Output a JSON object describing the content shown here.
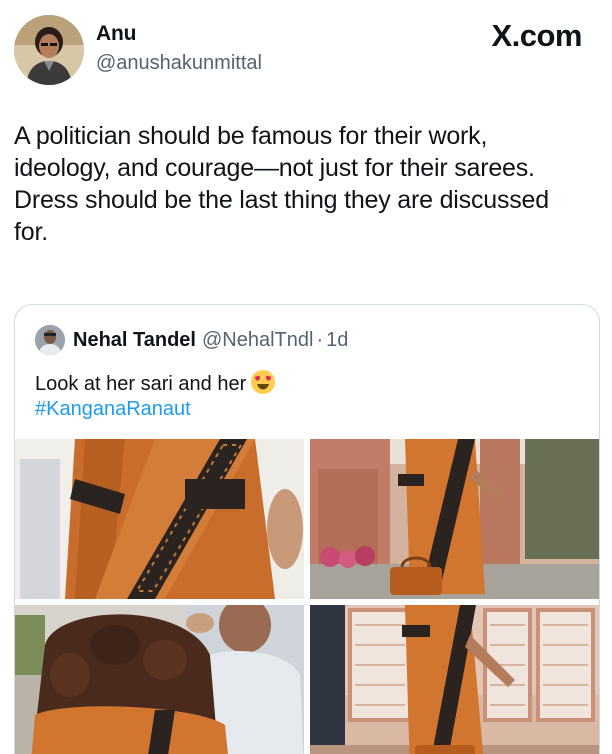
{
  "watermark": "X.com",
  "tweet": {
    "author_name": "Anu",
    "author_handle": "@anushakunmittal",
    "lines": [
      "A politician should be famous for their work,",
      "ideology, and courage—not just for their sarees.",
      "Dress should be the last thing they are discussed",
      "for."
    ]
  },
  "quoted": {
    "author_name": "Nehal Tandel",
    "author_handle": "@NehalTndl",
    "separator": "·",
    "time": "1d",
    "text": "Look at her sari and her",
    "emoji": "heart-eyes-emoji",
    "hashtag": "#KanganaRanaut",
    "photos": [
      "photo-1",
      "photo-2",
      "photo-3",
      "photo-4"
    ]
  },
  "colors": {
    "text": "#0f1419",
    "secondary": "#536471",
    "link": "#1d9bf0",
    "border": "#cfd9de",
    "saree_orange": "#d2762f",
    "saree_border": "#2a2320"
  }
}
